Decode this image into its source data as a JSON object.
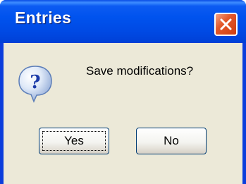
{
  "window": {
    "title": "Entries"
  },
  "dialog": {
    "message": "Save modifications?",
    "icon": "question-icon"
  },
  "buttons": {
    "yes_label": "Yes",
    "no_label": "No"
  },
  "colors": {
    "titlebar": "#0053ee",
    "close_button": "#e3582b",
    "client_background": "#ece9d8"
  }
}
